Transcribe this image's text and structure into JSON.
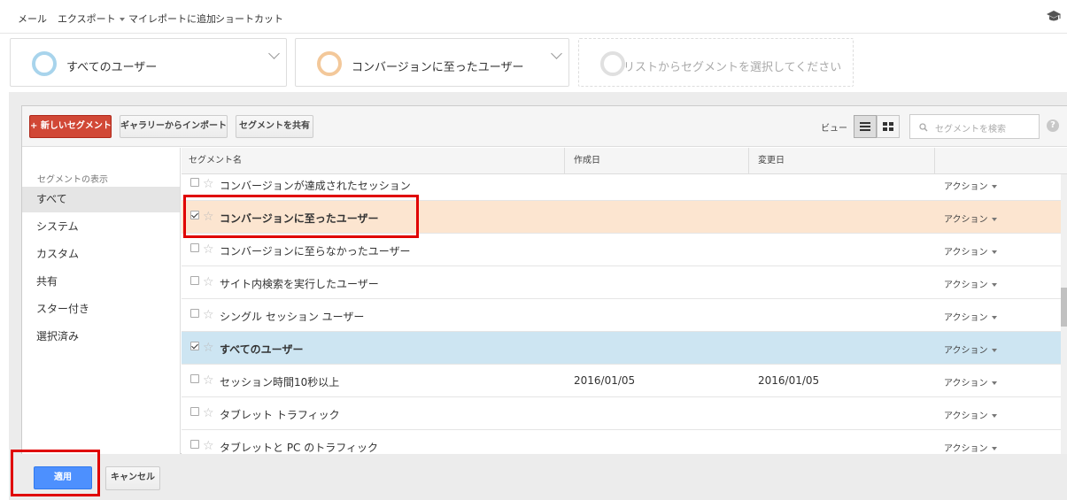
{
  "toolbar": {
    "mail": "メール",
    "export": "エクスポート",
    "add_to_my_report": "マイレポートに追加",
    "shortcut": "ショートカット"
  },
  "cards": [
    {
      "label": "すべてのユーザー",
      "ring_color": "#a8d4ec"
    },
    {
      "label": "コンバージョンに至ったユーザー",
      "ring_color": "#f3c89a"
    },
    {
      "label": "リストからセグメントを選択してください",
      "ring_color": "#e0e0e0"
    }
  ],
  "panel_toolbar": {
    "new_segment": "+ 新しいセグメント",
    "import_gallery": "ギャラリーからインポート",
    "share_segment": "セグメントを共有",
    "view_label": "ビュー",
    "search_placeholder": "セグメントを検索",
    "help": "?"
  },
  "sidebar": {
    "heading": "セグメントの表示",
    "items": [
      "すべて",
      "システム",
      "カスタム",
      "共有",
      "スター付き",
      "選択済み"
    ],
    "active_index": 0
  },
  "table": {
    "headers": [
      "セグメント名",
      "作成日",
      "変更日"
    ],
    "rows": [
      {
        "name": "コンバージョンが達成されたセッション",
        "created": "",
        "modified": "",
        "checked": false,
        "highlight": "",
        "action": "アクション"
      },
      {
        "name": "コンバージョンに至ったユーザー",
        "created": "",
        "modified": "",
        "checked": true,
        "highlight": "orange",
        "action": "アクション"
      },
      {
        "name": "コンバージョンに至らなかったユーザー",
        "created": "",
        "modified": "",
        "checked": false,
        "highlight": "",
        "action": "アクション"
      },
      {
        "name": "サイト内検索を実行したユーザー",
        "created": "",
        "modified": "",
        "checked": false,
        "highlight": "",
        "action": "アクション"
      },
      {
        "name": "シングル セッション ユーザー",
        "created": "",
        "modified": "",
        "checked": false,
        "highlight": "",
        "action": "アクション"
      },
      {
        "name": "すべてのユーザー",
        "created": "",
        "modified": "",
        "checked": true,
        "highlight": "blue",
        "action": "アクション"
      },
      {
        "name": "セッション時間10秒以上",
        "created": "2016/01/05",
        "modified": "2016/01/05",
        "checked": false,
        "highlight": "",
        "action": "アクション"
      },
      {
        "name": "タブレット トラフィック",
        "created": "",
        "modified": "",
        "checked": false,
        "highlight": "",
        "action": "アクション"
      },
      {
        "name": "タブレットと PC のトラフィック",
        "created": "",
        "modified": "",
        "checked": false,
        "highlight": "",
        "action": "アクション"
      }
    ]
  },
  "footer": {
    "apply": "適用",
    "cancel": "キャンセル"
  },
  "colors": {
    "new_segment_red": "#d14836",
    "apply_blue": "#4d90fe",
    "highlight_orange": "#fce5d0",
    "highlight_blue": "#cde5f2",
    "annotation_red": "#e00000"
  }
}
